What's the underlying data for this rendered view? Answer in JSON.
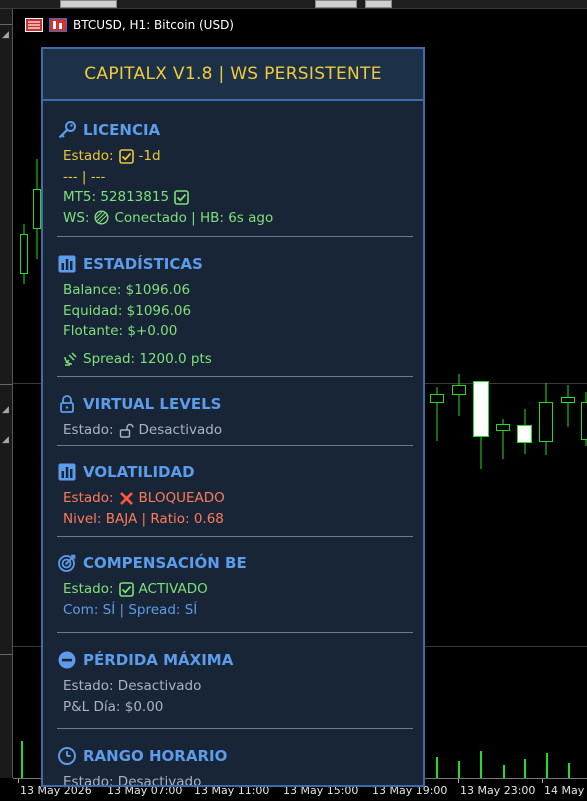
{
  "chart": {
    "symbol_line": "BTCUSD, H1:  Bitcoin (USD)",
    "icons": [
      "terminal-icon",
      "chart-type-icon"
    ],
    "time_axis": [
      "13 May 2026",
      "13 May 07:00",
      "13 May 11:00",
      "13 May 15:00",
      "13 May 19:00",
      "13 May 23:00",
      "14 May"
    ],
    "colors": {
      "background": "#000000",
      "candle_border": "#22dd22",
      "bull_body": "#ffffff",
      "bear_body": "#000000"
    }
  },
  "panel": {
    "title": "CAPITALX V1.8 | WS PERSISTENTE",
    "colors": {
      "background": "#182536",
      "border": "#3d6ca6",
      "title": "#f0cc3a",
      "section_title": "#5c9cea"
    },
    "licencia": {
      "title": "LICENCIA",
      "estado_label": "Estado:",
      "estado_value": "-1d",
      "dashes": "--- | ---",
      "mt5_label": "MT5: 52813815",
      "ws_label": "WS:",
      "ws_value": "Conectado | HB: 6s ago"
    },
    "estadisticas": {
      "title": "ESTADÍSTICAS",
      "balance": "Balance: $1096.06",
      "equidad": "Equidad: $1096.06",
      "flotante": "Flotante: $+0.00",
      "spread": "Spread: 1200.0 pts"
    },
    "virtual_levels": {
      "title": "VIRTUAL LEVELS",
      "estado_label": "Estado:",
      "estado_value": "Desactivado"
    },
    "volatilidad": {
      "title": "VOLATILIDAD",
      "estado_label": "Estado:",
      "estado_value": "BLOQUEADO",
      "nivel": "Nivel: BAJA | Ratio: 0.68"
    },
    "compensacion": {
      "title": "COMPENSACIÓN BE",
      "estado_label": "Estado:",
      "estado_value": "ACTIVADO",
      "com": "Com: SÍ | Spread: SÍ"
    },
    "perdida": {
      "title": "PÉRDIDA MÁXIMA",
      "estado": "Estado: Desactivado",
      "pnl": "P&L Día: $0.00"
    },
    "rango": {
      "title": "RANGO HORARIO",
      "estado": "Estado: Desactivado"
    }
  }
}
